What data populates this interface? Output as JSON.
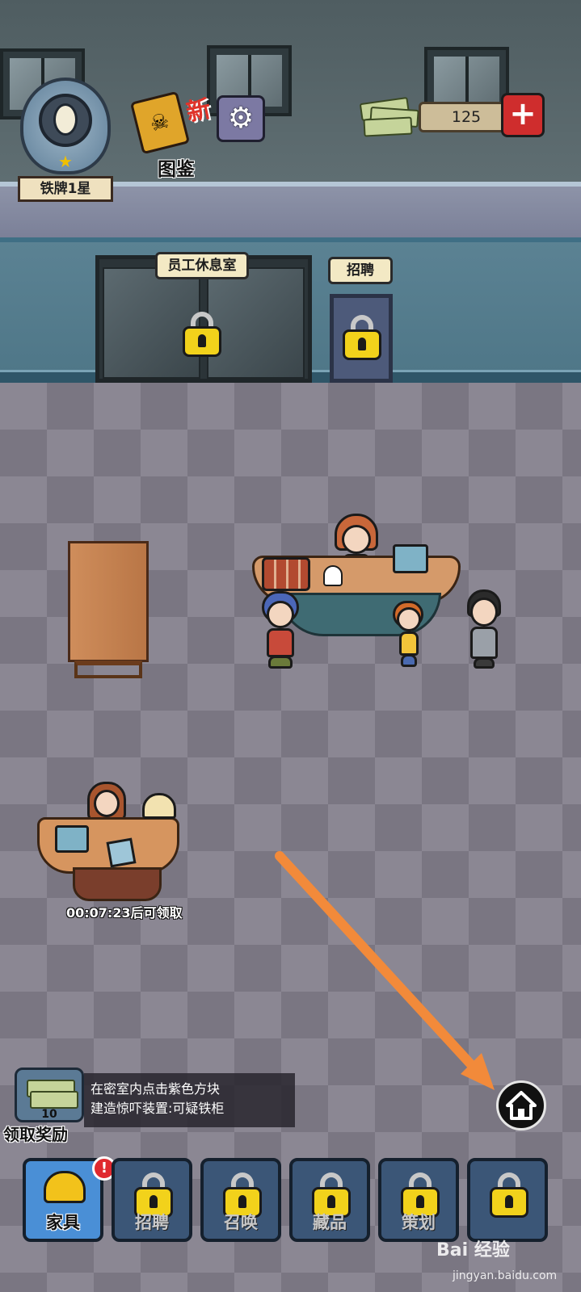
{
  "hud": {
    "rank_label": "铁牌1星",
    "codex_label": "图鉴",
    "new_tag": "新",
    "cash_value": "125",
    "plus_symbol": "+"
  },
  "rooms": {
    "staff_lounge_sign": "员工休息室",
    "recruit_sign": "招聘"
  },
  "reception": {
    "timer_text": "00:07:23后可领取"
  },
  "quest": {
    "reward_count": "10",
    "line1": "在密室内点击紫色方块",
    "line2": "建造惊吓装置:可疑铁柜",
    "claim_label": "领取奖励"
  },
  "tabs": [
    {
      "label": "家具",
      "locked": false,
      "alert": "!"
    },
    {
      "label": "招聘",
      "locked": true
    },
    {
      "label": "召唤",
      "locked": true
    },
    {
      "label": "藏品",
      "locked": true
    },
    {
      "label": "策划",
      "locked": true
    },
    {
      "label": "",
      "locked": true
    }
  ],
  "watermark": {
    "brand": "Bai 经验",
    "url": "jingyan.baidu.com"
  },
  "colors": {
    "arrow": "#f28a3a",
    "lock_yellow": "#f2d21b",
    "plus_red": "#cf2d2d",
    "active_tab": "#4a8fd6"
  },
  "icons": [
    "settings-gear-icon",
    "skull-book-icon",
    "cash-stack-icon",
    "lock-icon",
    "home-icon",
    "helmet-tools-icon"
  ]
}
